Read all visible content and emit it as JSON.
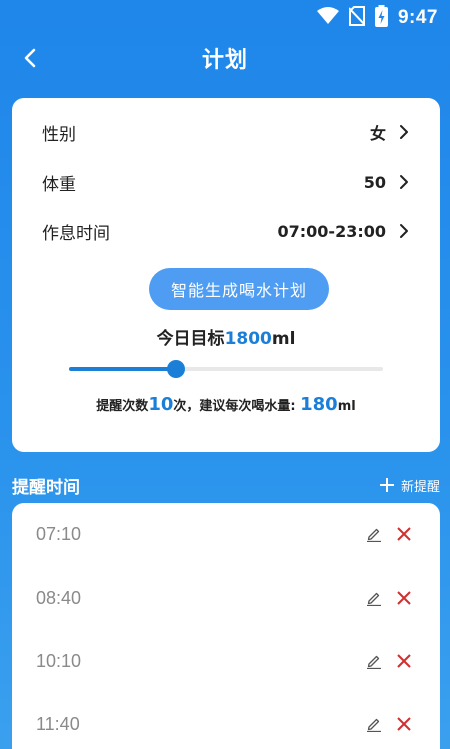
{
  "status": {
    "time": "9:47"
  },
  "header": {
    "title": "计划"
  },
  "settings": [
    {
      "label": "性别",
      "value": "女"
    },
    {
      "label": "体重",
      "value": "50"
    },
    {
      "label": "作息时间",
      "value": "07:00-23:00"
    }
  ],
  "generate_button": "智能生成喝水计划",
  "goal": {
    "prefix": "今日目标",
    "amount": "1800",
    "unit": "ml"
  },
  "slider": {
    "level": 0.34
  },
  "hint": {
    "prefix": "提醒次数",
    "count": "10",
    "middle": "次，建议每次喝水量:",
    "amount": "180",
    "unit": "ml"
  },
  "reminders": {
    "title": "提醒时间",
    "new_label": "新提醒",
    "times": [
      "07:10",
      "08:40",
      "10:10",
      "11:40"
    ]
  },
  "colors": {
    "primary": "#1b7fd8",
    "button": "#4e9df2",
    "delete": "#d32f2f"
  }
}
